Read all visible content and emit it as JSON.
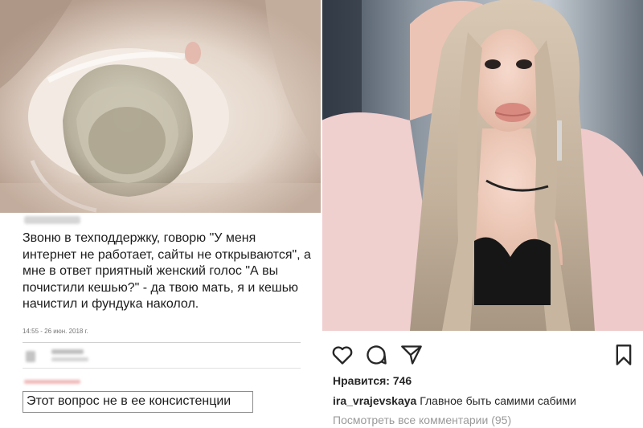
{
  "tweet": {
    "text": "Звоню в техподдержку, говорю \"У меня интернет не работает, сайты не открываются\", а мне в ответ приятный женский голос \"А вы почистили кешью?\" - да твою мать, я и кешью начистил и фундука наколол.",
    "timestamp": "14:55 - 26 июн. 2018 г.",
    "reply_text": "Этот вопрос не в ее консистенции"
  },
  "instagram": {
    "likes_label": "Нравится: 746",
    "username": "ira_vrajevskaya",
    "caption": "Главное быть самими сабими",
    "view_comments": "Посмотреть все комментарии (95)",
    "icons": [
      "heart-icon",
      "comment-icon",
      "share-icon",
      "bookmark-icon"
    ]
  },
  "colors": {
    "text_primary": "#1c1c1c",
    "instagram_text": "#262626",
    "muted": "#9a9a9a",
    "jacket_pink": "#f2cfcf"
  }
}
